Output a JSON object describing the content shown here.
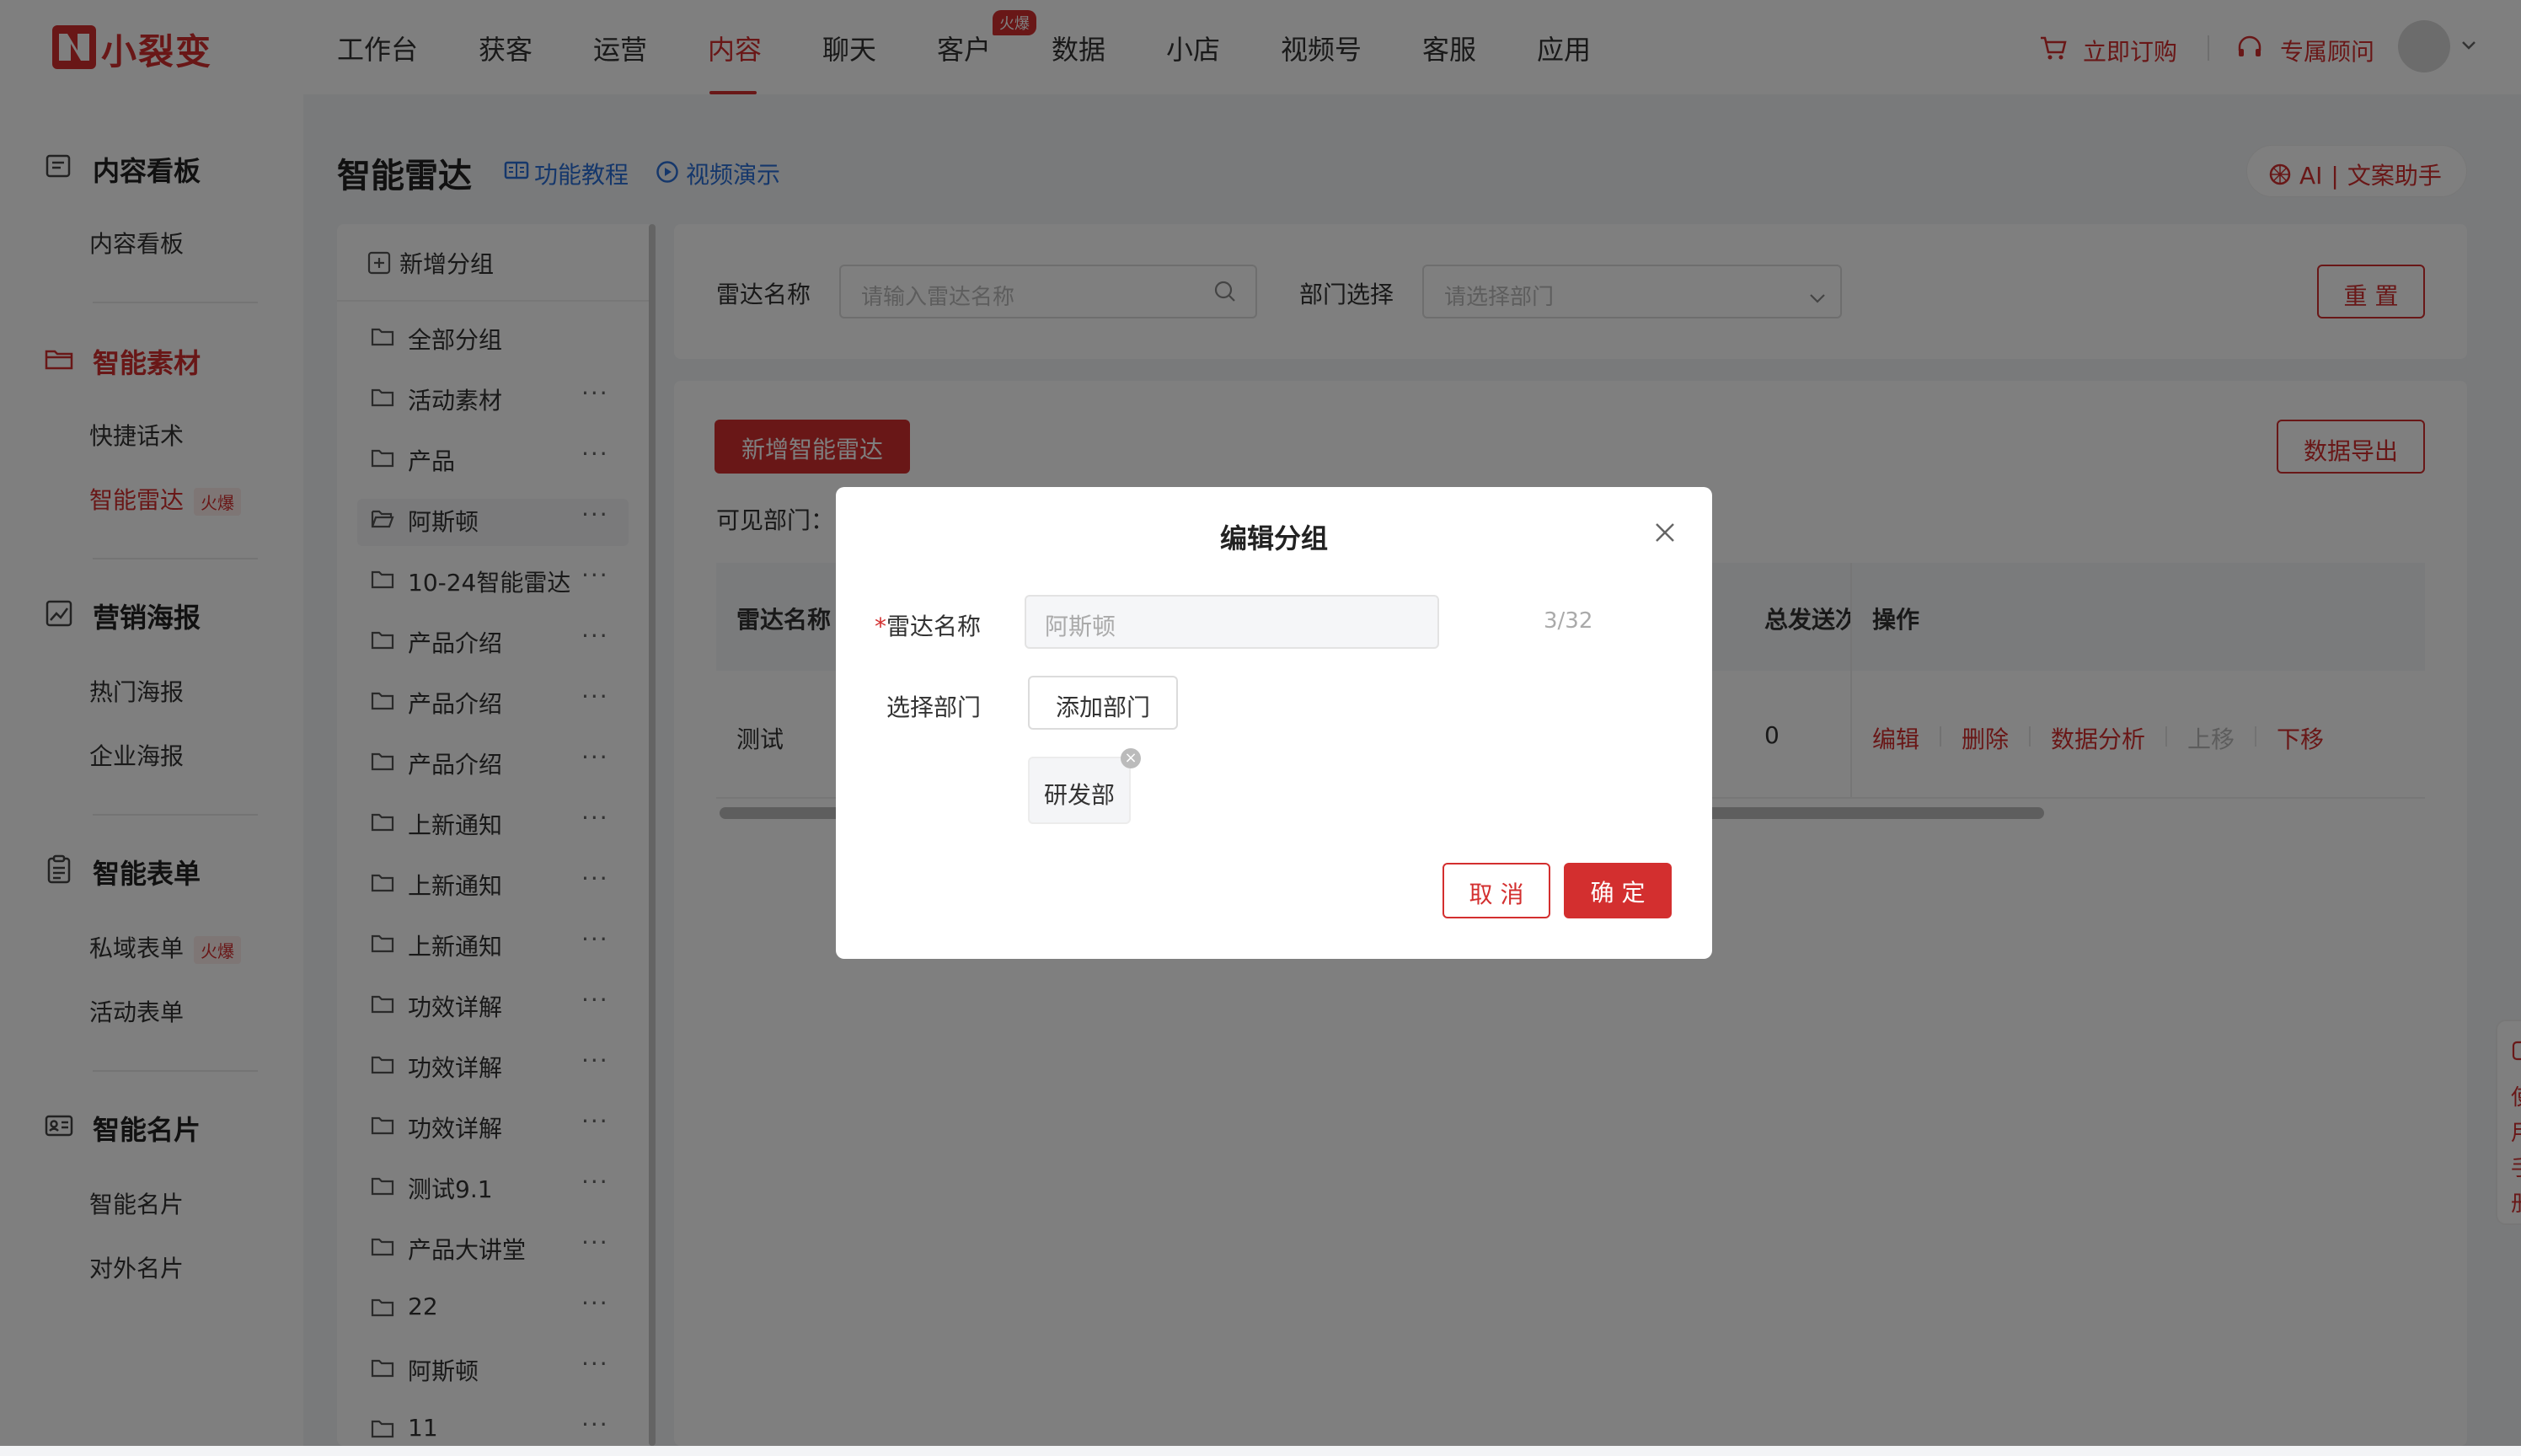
{
  "brand": {
    "name": "小裂变",
    "color": "#d32f2f"
  },
  "nav": {
    "items": [
      "工作台",
      "获客",
      "运营",
      "内容",
      "聊天",
      "客户",
      "数据",
      "小店",
      "视频号",
      "客服",
      "应用"
    ],
    "active": "内容",
    "hot_badge": "火爆"
  },
  "topright": {
    "order": "立即订购",
    "advisor": "专属顾问"
  },
  "sidebar": {
    "sections": [
      {
        "title": "内容看板",
        "icon": "dashboard-icon",
        "items": [
          "内容看板"
        ]
      },
      {
        "title": "智能素材",
        "icon": "folder-icon",
        "items": [
          "快捷话术",
          "智能雷达"
        ]
      },
      {
        "title": "营销海报",
        "icon": "poster-icon",
        "items": [
          "热门海报",
          "企业海报"
        ]
      },
      {
        "title": "智能表单",
        "icon": "form-icon",
        "items": [
          "私域表单",
          "活动表单"
        ]
      },
      {
        "title": "智能名片",
        "icon": "card-icon",
        "items": [
          "智能名片",
          "对外名片"
        ]
      }
    ],
    "fire_label": "火爆"
  },
  "page": {
    "title": "智能雷达",
    "tutorial": "功能教程",
    "video": "视频演示",
    "ai_label": "AI",
    "ai_helper": "文案助手"
  },
  "groups": {
    "new_label": "新增分组",
    "items": [
      "全部分组",
      "活动素材",
      "产品",
      "阿斯顿",
      "10-24智能雷达",
      "产品介绍",
      "产品介绍",
      "产品介绍",
      "上新通知",
      "上新通知",
      "上新通知",
      "功效详解",
      "功效详解",
      "功效详解",
      "测试9.1",
      "产品大讲堂",
      "22",
      "阿斯顿",
      "11"
    ],
    "selected_index": 3,
    "more_icon": "···"
  },
  "filter": {
    "name_label": "雷达名称",
    "name_placeholder": "请输入雷达名称",
    "dept_label": "部门选择",
    "dept_placeholder": "请选择部门",
    "reset": "重 置"
  },
  "main": {
    "add_button": "新增智能雷达",
    "export_button": "数据导出",
    "visible_dept_label": "可见部门："
  },
  "table": {
    "columns": [
      "雷达名称",
      "总发送次",
      "操作"
    ],
    "rows": [
      {
        "name": "测试",
        "sends": "0",
        "ops": [
          "编辑",
          "删除",
          "数据分析",
          "上移",
          "下移"
        ]
      }
    ]
  },
  "side_float": {
    "chars": [
      "使",
      "用",
      "手",
      "册"
    ]
  },
  "dialog": {
    "title": "编辑分组",
    "name_label": "雷达名称",
    "required_mark": "*",
    "name_value": "阿斯顿",
    "count": "3/32",
    "dept_label": "选择部门",
    "add_dept": "添加部门",
    "chip": "研发部",
    "cancel": "取 消",
    "ok": "确 定"
  }
}
